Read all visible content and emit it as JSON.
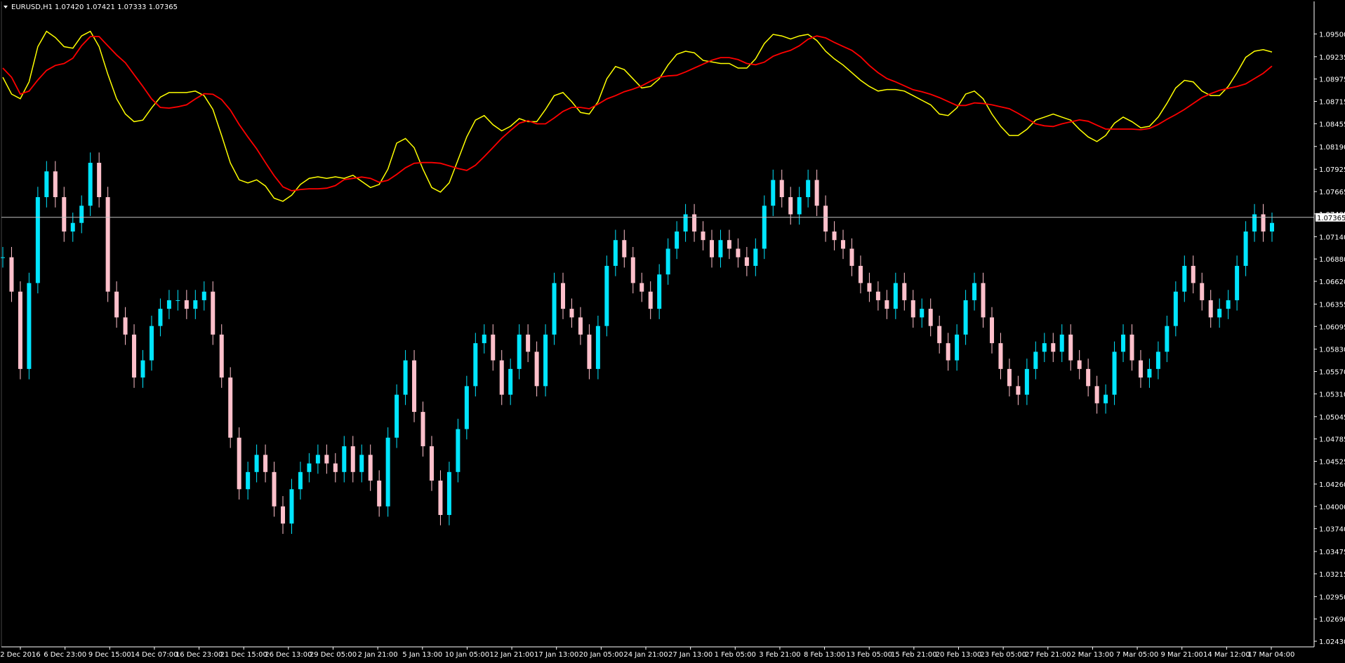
{
  "header": {
    "symbol": "EURUSD,H1",
    "ohlc": "1.07420 1.07421 1.07333 1.07365"
  },
  "current_price_label": "1.07365",
  "colors": {
    "background": "#000000",
    "axis": "#ffffff",
    "candle_up": "#00e5ff",
    "candle_down": "#ffc0cb",
    "indicator_fast": "#ffff00",
    "indicator_slow": "#ff0000",
    "price_line": "#c0c0c0"
  },
  "chart_data": {
    "type": "candlestick",
    "title": "EURUSD,H1",
    "ylim": [
      1.0243,
      1.0965
    ],
    "y_ticks": [
      "1.09500",
      "1.09235",
      "1.08975",
      "1.08715",
      "1.08455",
      "1.08190",
      "1.07925",
      "1.07665",
      "1.07405",
      "1.07140",
      "1.06880",
      "1.06620",
      "1.06355",
      "1.06095",
      "1.05830",
      "1.05570",
      "1.05310",
      "1.05045",
      "1.04785",
      "1.04525",
      "1.04260",
      "1.04000",
      "1.03740",
      "1.03475",
      "1.03215",
      "1.02950",
      "1.02690",
      "1.02430"
    ],
    "x_ticks": [
      "2 Dec 2016",
      "6 Dec 23:00",
      "9 Dec 15:00",
      "14 Dec 07:00",
      "16 Dec 23:00",
      "21 Dec 15:00",
      "26 Dec 13:00",
      "29 Dec 05:00",
      "2 Jan 21:00",
      "5 Jan 13:00",
      "10 Jan 05:00",
      "12 Jan 21:00",
      "17 Jan 13:00",
      "20 Jan 05:00",
      "24 Jan 21:00",
      "27 Jan 13:00",
      "1 Feb 05:00",
      "3 Feb 21:00",
      "8 Feb 13:00",
      "13 Feb 05:00",
      "15 Feb 21:00",
      "20 Feb 13:00",
      "23 Feb 05:00",
      "27 Feb 21:00",
      "2 Mar 13:00",
      "7 Mar 05:00",
      "9 Mar 21:00",
      "14 Mar 12:00",
      "17 Mar 04:00"
    ],
    "last_price": 1.07365,
    "series": [
      {
        "kind": "close",
        "values": [
          1.069,
          1.065,
          1.056,
          1.066,
          1.076,
          1.079,
          1.076,
          1.072,
          1.073,
          1.075,
          1.08,
          1.076,
          1.065,
          1.062,
          1.06,
          1.055,
          1.057,
          1.061,
          1.063,
          1.064,
          1.064,
          1.063,
          1.064,
          1.065,
          1.06,
          1.055,
          1.048,
          1.042,
          1.044,
          1.046,
          1.044,
          1.04,
          1.038,
          1.042,
          1.044,
          1.045,
          1.046,
          1.045,
          1.044,
          1.047,
          1.044,
          1.046,
          1.043,
          1.04,
          1.048,
          1.053,
          1.057,
          1.051,
          1.047,
          1.043,
          1.039,
          1.044,
          1.049,
          1.054,
          1.059,
          1.06,
          1.057,
          1.053,
          1.056,
          1.06,
          1.058,
          1.054,
          1.06,
          1.066,
          1.063,
          1.062,
          1.06,
          1.056,
          1.061,
          1.068,
          1.071,
          1.069,
          1.066,
          1.065,
          1.063,
          1.067,
          1.07,
          1.072,
          1.074,
          1.072,
          1.071,
          1.069,
          1.071,
          1.07,
          1.069,
          1.068,
          1.07,
          1.075,
          1.078,
          1.076,
          1.074,
          1.076,
          1.078,
          1.075,
          1.072,
          1.071,
          1.07,
          1.068,
          1.066,
          1.065,
          1.064,
          1.063,
          1.066,
          1.064,
          1.062,
          1.063,
          1.061,
          1.059,
          1.057,
          1.06,
          1.064,
          1.066,
          1.062,
          1.059,
          1.056,
          1.054,
          1.053,
          1.056,
          1.058,
          1.059,
          1.058,
          1.06,
          1.057,
          1.056,
          1.054,
          1.052,
          1.053,
          1.058,
          1.06,
          1.057,
          1.055,
          1.056,
          1.058,
          1.061,
          1.065,
          1.068,
          1.066,
          1.064,
          1.062,
          1.063,
          1.064,
          1.068,
          1.072,
          1.074,
          1.072,
          1.073
        ]
      },
      {
        "kind": "moving_average",
        "name": "",
        "values": []
      },
      {
        "kind": "moving_average",
        "name": "",
        "values": []
      }
    ],
    "notes": "Upper panel shows two overlaid lines (yellow and red) drawn on a rescaled band above the candles."
  }
}
